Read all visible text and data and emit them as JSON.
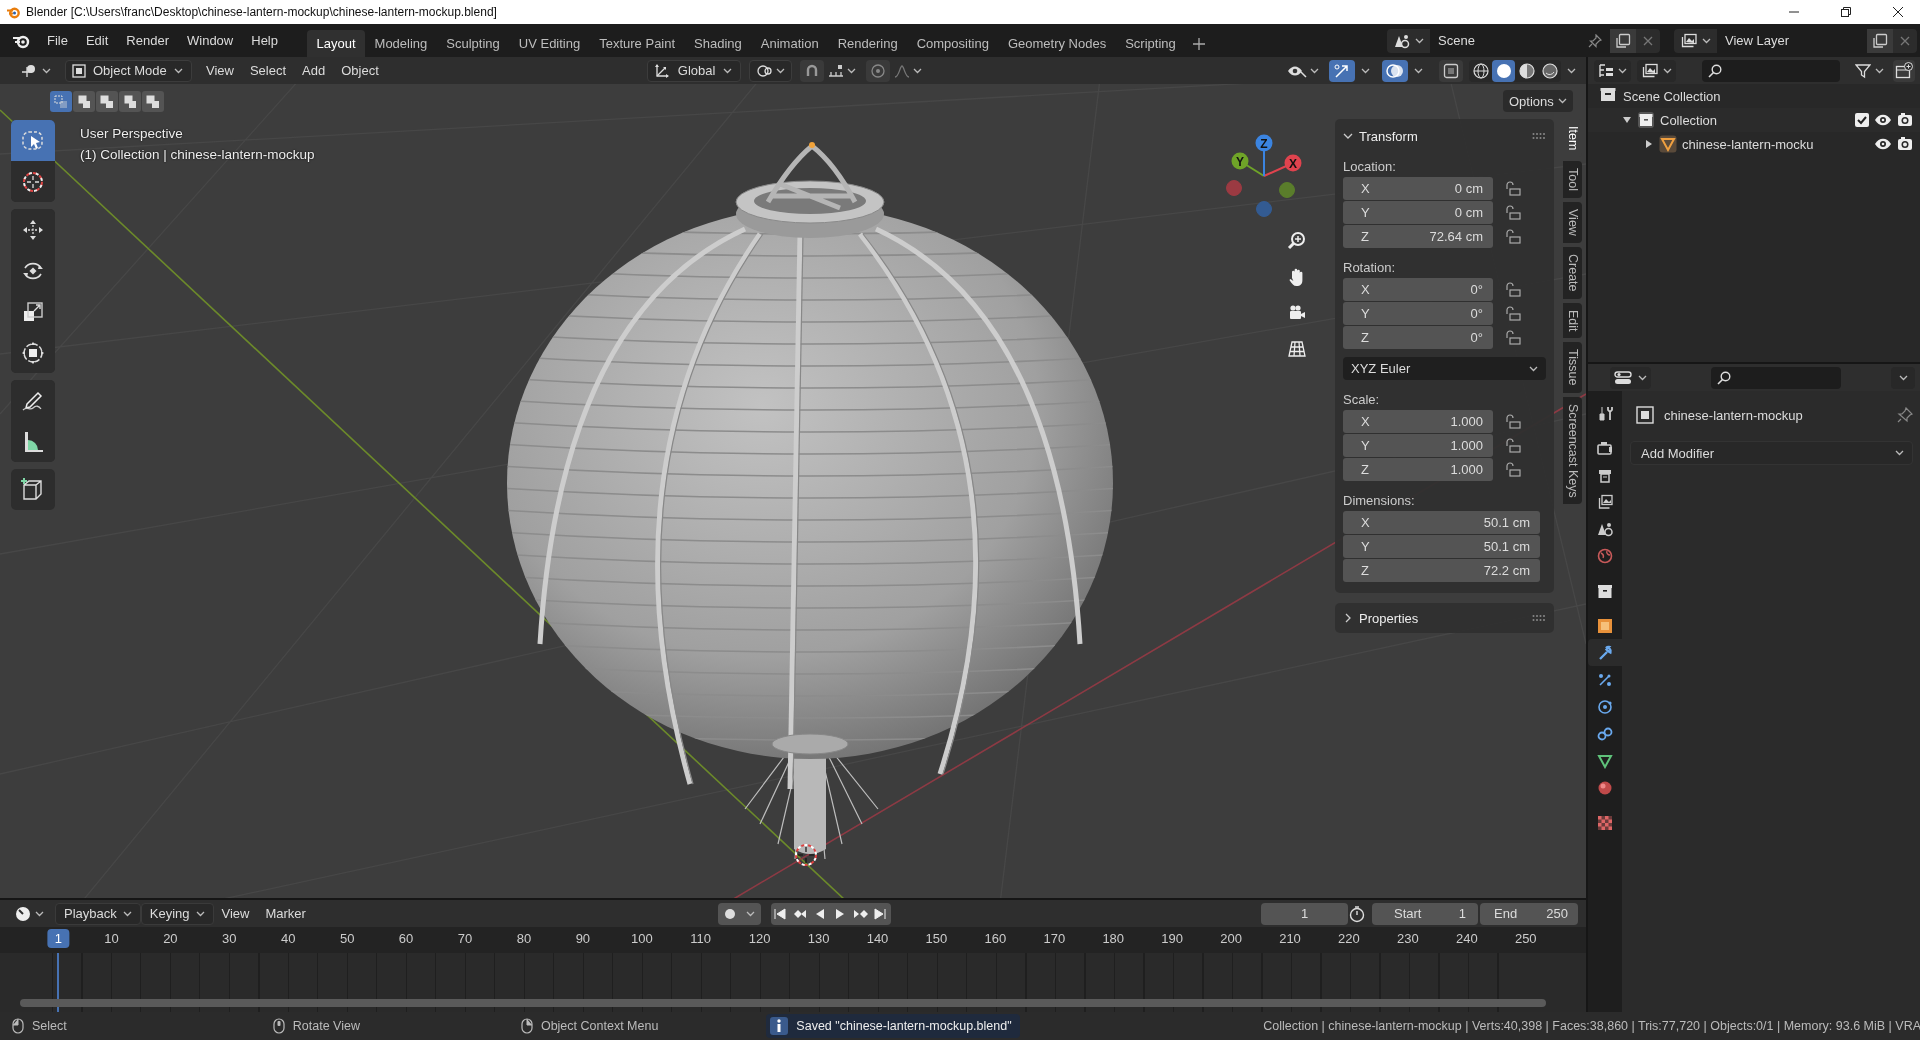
{
  "window": {
    "title": "Blender [C:\\Users\\franc\\Desktop\\chinese-lantern-mockup\\chinese-lantern-mockup.blend]"
  },
  "menus": [
    "File",
    "Edit",
    "Render",
    "Window",
    "Help"
  ],
  "workspaces": [
    {
      "label": "Layout",
      "selected": true
    },
    {
      "label": "Modeling",
      "selected": false
    },
    {
      "label": "Sculpting",
      "selected": false
    },
    {
      "label": "UV Editing",
      "selected": false
    },
    {
      "label": "Texture Paint",
      "selected": false
    },
    {
      "label": "Shading",
      "selected": false
    },
    {
      "label": "Animation",
      "selected": false
    },
    {
      "label": "Rendering",
      "selected": false
    },
    {
      "label": "Compositing",
      "selected": false
    },
    {
      "label": "Geometry Nodes",
      "selected": false
    },
    {
      "label": "Scripting",
      "selected": false
    }
  ],
  "scene": "Scene",
  "view_layer": "View Layer",
  "viewport": {
    "mode": "Object Mode",
    "menus": [
      "View",
      "Select",
      "Add",
      "Object"
    ],
    "orientation": "Global",
    "select_modes": [
      {
        "selected": true
      },
      {
        "selected": false
      },
      {
        "selected": false
      },
      {
        "selected": false
      },
      {
        "selected": false
      }
    ],
    "show_gizmos": true,
    "show_overlays": true,
    "xray": false,
    "shading": [
      {
        "kind": "wireframe",
        "selected": false
      },
      {
        "kind": "solid",
        "selected": true
      },
      {
        "kind": "material",
        "selected": false
      },
      {
        "kind": "rendered",
        "selected": false
      }
    ],
    "options": "Options",
    "view_name": "User Perspective",
    "view_info": "(1) Collection | chinese-lantern-mockup",
    "gizmo_axes": [
      "X",
      "Y",
      "Z"
    ],
    "tool_groups": [
      [
        {
          "kind": "select_box",
          "selected": true
        },
        {
          "kind": "cursor",
          "selected": false
        }
      ],
      [
        {
          "kind": "move",
          "selected": false
        },
        {
          "kind": "rotate",
          "selected": false
        },
        {
          "kind": "scale",
          "selected": false
        },
        {
          "kind": "transform",
          "selected": false
        }
      ],
      [
        {
          "kind": "annotate",
          "selected": false
        },
        {
          "kind": "measure",
          "selected": false
        }
      ],
      [
        {
          "kind": "add_cube",
          "selected": false
        }
      ]
    ]
  },
  "sidebar": {
    "tabs": [
      {
        "label": "Item",
        "selected": true
      },
      {
        "label": "Tool",
        "selected": false
      },
      {
        "label": "View",
        "selected": false
      },
      {
        "label": "Create",
        "selected": false
      },
      {
        "label": "Edit",
        "selected": false
      },
      {
        "label": "Tissue",
        "selected": false
      },
      {
        "label": "Screencast Keys",
        "selected": false
      }
    ],
    "panels": [
      {
        "title": "Transform",
        "expanded": true,
        "groups": [
          {
            "kind": "fields",
            "label": "Location:",
            "fields": [
              {
                "axis": "X",
                "value": "0 cm",
                "locked": false
              },
              {
                "axis": "Y",
                "value": "0 cm",
                "locked": false
              },
              {
                "axis": "Z",
                "value": "72.64 cm",
                "locked": false
              }
            ]
          },
          {
            "kind": "fields",
            "label": "Rotation:",
            "fields": [
              {
                "axis": "X",
                "value": "0°",
                "locked": false
              },
              {
                "axis": "Y",
                "value": "0°",
                "locked": false
              },
              {
                "axis": "Z",
                "value": "0°",
                "locked": false
              }
            ]
          },
          {
            "kind": "dropdown",
            "value": "XYZ Euler"
          },
          {
            "kind": "fields",
            "label": "Scale:",
            "fields": [
              {
                "axis": "X",
                "value": "1.000",
                "locked": false
              },
              {
                "axis": "Y",
                "value": "1.000",
                "locked": false
              },
              {
                "axis": "Z",
                "value": "1.000",
                "locked": false
              }
            ]
          },
          {
            "kind": "fields",
            "label": "Dimensions:",
            "fields": [
              {
                "axis": "X",
                "value": "50.1 cm"
              },
              {
                "axis": "Y",
                "value": "50.1 cm"
              },
              {
                "axis": "Z",
                "value": "72.2 cm"
              }
            ]
          }
        ]
      },
      {
        "title": "Properties",
        "expanded": false
      }
    ]
  },
  "outliner": {
    "tree": [
      {
        "label": "Scene Collection",
        "kind": "scene_collection",
        "children": [
          {
            "label": "Collection",
            "kind": "collection",
            "expanded": true,
            "checked": true,
            "children": [
              {
                "label": "chinese-lantern-mocku",
                "kind": "mesh",
                "expanded": false
              }
            ]
          }
        ]
      }
    ]
  },
  "properties": {
    "tab_groups": [
      [
        {
          "kind": "tool",
          "selected": false
        }
      ],
      [
        {
          "kind": "render",
          "selected": false
        },
        {
          "kind": "output",
          "selected": false
        },
        {
          "kind": "view_layer",
          "selected": false
        },
        {
          "kind": "scene",
          "selected": false
        },
        {
          "kind": "world",
          "selected": false
        }
      ],
      [
        {
          "kind": "collection",
          "selected": false
        }
      ],
      [
        {
          "kind": "object",
          "selected": false
        },
        {
          "kind": "modifiers",
          "selected": true
        },
        {
          "kind": "particles",
          "selected": false
        },
        {
          "kind": "physics",
          "selected": false
        },
        {
          "kind": "constraints",
          "selected": false
        },
        {
          "kind": "data",
          "selected": false
        },
        {
          "kind": "material",
          "selected": false
        }
      ],
      [
        {
          "kind": "texture",
          "selected": false
        }
      ]
    ],
    "object_name": "chinese-lantern-mockup",
    "add_modifier": "Add Modifier"
  },
  "timeline": {
    "menus": [
      "Playback",
      "Keying",
      "View",
      "Marker"
    ],
    "current_frame": "1",
    "start_label": "Start",
    "start": "1",
    "end_label": "End",
    "end": "250",
    "ruler": [
      {
        "label": "1",
        "selected": true
      },
      {
        "label": "10",
        "selected": false
      },
      {
        "label": "20",
        "selected": false
      },
      {
        "label": "30",
        "selected": false
      },
      {
        "label": "40",
        "selected": false
      },
      {
        "label": "50",
        "selected": false
      },
      {
        "label": "60",
        "selected": false
      },
      {
        "label": "70",
        "selected": false
      },
      {
        "label": "80",
        "selected": false
      },
      {
        "label": "90",
        "selected": false
      },
      {
        "label": "100",
        "selected": false
      },
      {
        "label": "110",
        "selected": false
      },
      {
        "label": "120",
        "selected": false
      },
      {
        "label": "130",
        "selected": false
      },
      {
        "label": "140",
        "selected": false
      },
      {
        "label": "150",
        "selected": false
      },
      {
        "label": "160",
        "selected": false
      },
      {
        "label": "170",
        "selected": false
      },
      {
        "label": "180",
        "selected": false
      },
      {
        "label": "190",
        "selected": false
      },
      {
        "label": "200",
        "selected": false
      },
      {
        "label": "210",
        "selected": false
      },
      {
        "label": "220",
        "selected": false
      },
      {
        "label": "230",
        "selected": false
      },
      {
        "label": "240",
        "selected": false
      },
      {
        "label": "250",
        "selected": false
      }
    ]
  },
  "status_bar": {
    "hints": [
      "Select",
      "Rotate View",
      "Object Context Menu"
    ],
    "message": "Saved \"chinese-lantern-mockup.blend\"",
    "stats": "Collection | chinese-lantern-mockup | Verts:40,398 | Faces:38,860 | Tris:77,720 | Objects:0/1 | Memory: 93.6 MiB | VRA"
  }
}
